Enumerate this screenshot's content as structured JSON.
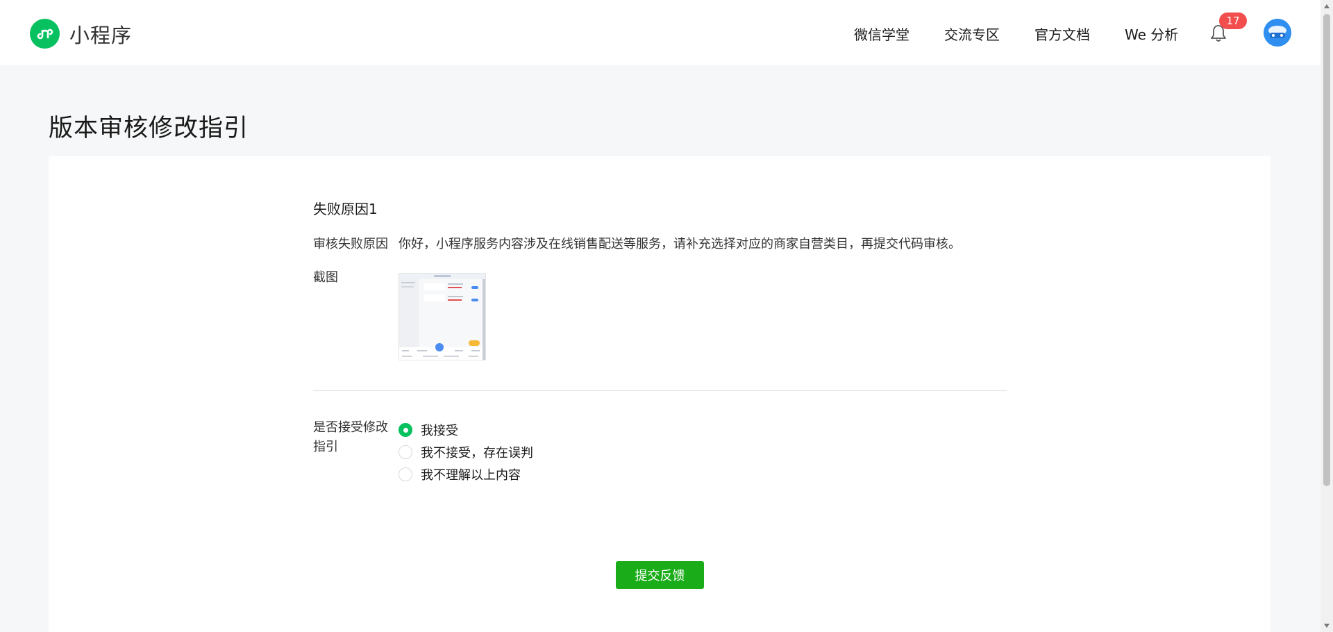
{
  "header": {
    "app_name": "小程序",
    "nav": [
      "微信学堂",
      "交流专区",
      "官方文档",
      "We 分析"
    ],
    "notification_count": "17"
  },
  "page": {
    "title": "版本审核修改指引"
  },
  "reason": {
    "heading": "失败原因1",
    "fail_label": "审核失败原因",
    "fail_text": "你好，小程序服务内容涉及在线销售配送等服务，请补充选择对应的商家自营类目，再提交代码审核。",
    "screenshot_label": "截图"
  },
  "accept": {
    "label": "是否接受修改指引",
    "options": [
      {
        "label": "我接受",
        "checked": true
      },
      {
        "label": "我不接受，存在误判",
        "checked": false
      },
      {
        "label": "我不理解以上内容",
        "checked": false
      }
    ]
  },
  "submit_label": "提交反馈",
  "colors": {
    "brand": "#07c160",
    "button": "#1aad19",
    "badge": "#f24e4e"
  }
}
